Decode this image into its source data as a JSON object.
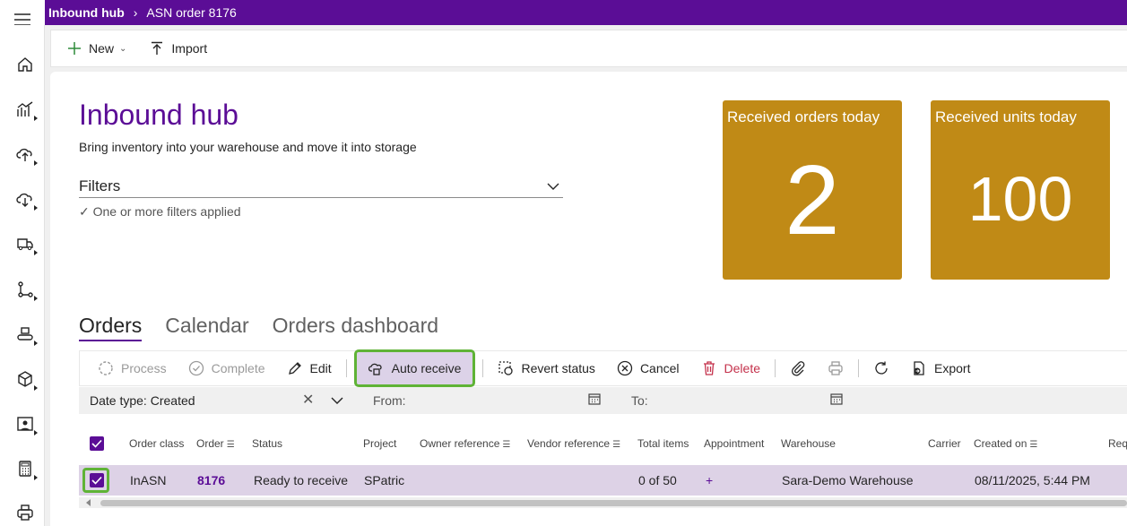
{
  "topbar": {
    "root": "Inbound hub",
    "separator": "›",
    "current": "ASN order 8176"
  },
  "actionbar": {
    "new_label": "New",
    "import_label": "Import"
  },
  "page": {
    "title": "Inbound hub",
    "subtitle": "Bring inventory into your warehouse and move it into storage",
    "filters_label": "Filters",
    "filters_note": "✓ One or more filters applied"
  },
  "tiles": [
    {
      "label": "Received orders today",
      "value": "2"
    },
    {
      "label": "Received units today",
      "value": "100"
    }
  ],
  "tabs": [
    "Orders",
    "Calendar",
    "Orders dashboard"
  ],
  "toolbar": {
    "process": "Process",
    "complete": "Complete",
    "edit": "Edit",
    "auto_receive": "Auto receive",
    "revert_status": "Revert status",
    "cancel": "Cancel",
    "delete": "Delete",
    "export": "Export"
  },
  "filterrow": {
    "date_type_label": "Date type:",
    "date_type_value": "Created",
    "from_label": "From:",
    "to_label": "To:"
  },
  "grid": {
    "columns": [
      "Order class",
      "Order",
      "Status",
      "Project",
      "Owner reference",
      "Vendor reference",
      "Total items",
      "Appointment",
      "Warehouse",
      "Carrier",
      "Created on",
      "Req"
    ],
    "row": {
      "order_class": "InASN",
      "order": "8176",
      "status": "Ready to receive",
      "project": "SPatric",
      "total_items": "0 of 50",
      "appointment": "+",
      "warehouse": "Sara-Demo Warehouse",
      "created_on": "08/11/2025, 5:44 PM"
    }
  },
  "colors": {
    "brand": "#5b0d96",
    "tile": "#c08a16",
    "highlight": "#5fb336",
    "selected_row": "#ddd2e6"
  }
}
